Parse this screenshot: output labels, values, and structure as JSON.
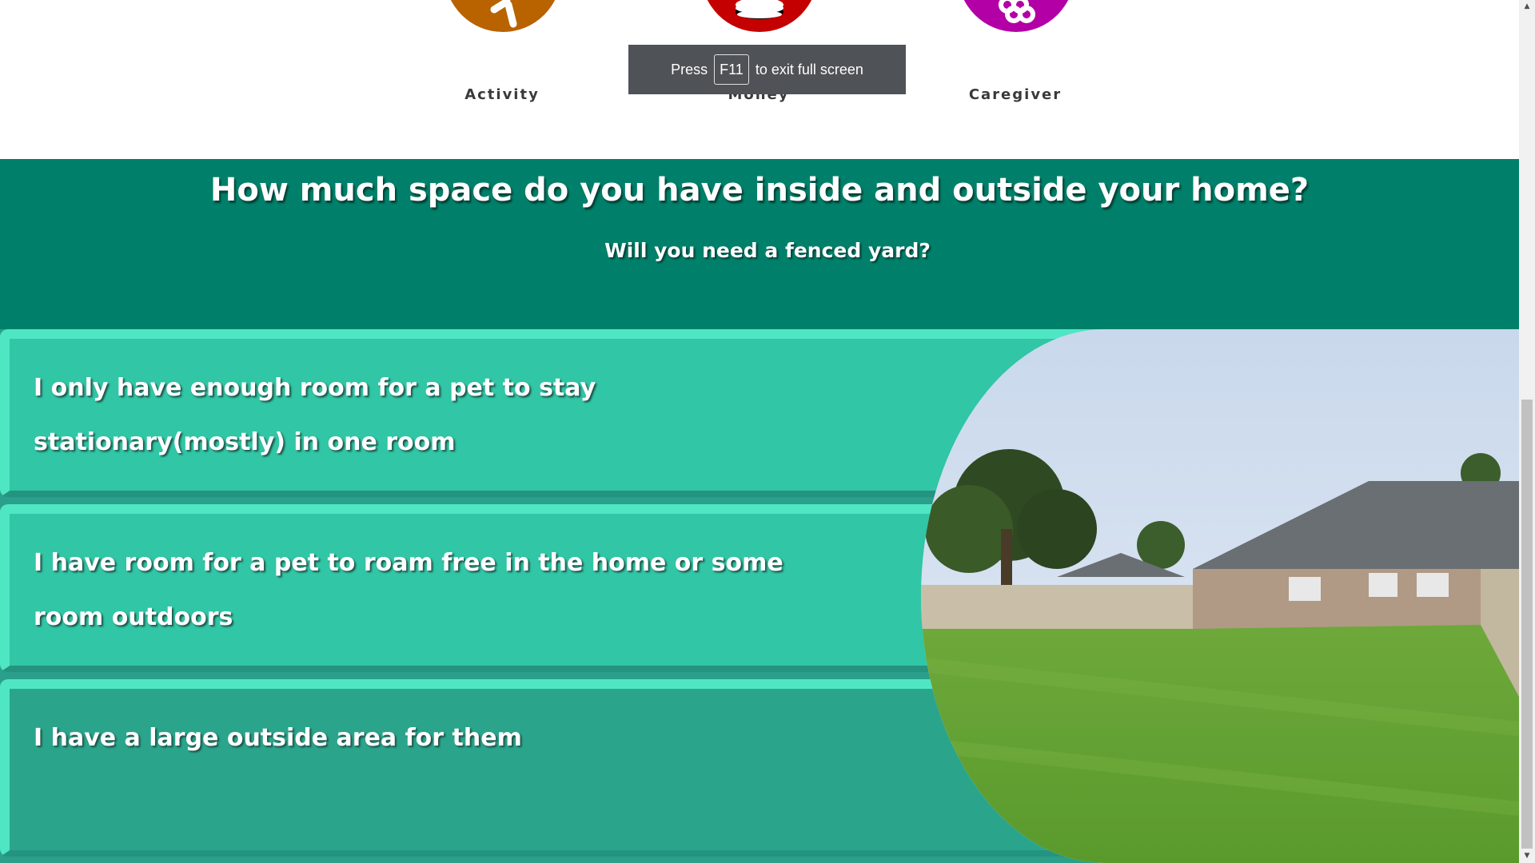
{
  "categories": [
    {
      "label": "Activity",
      "icon": "running-figure-icon",
      "color": "#b86200"
    },
    {
      "label": "Money",
      "icon": "coin-stack-icon",
      "color": "#c40000"
    },
    {
      "label": "Caregiver",
      "icon": "hands-icon",
      "color": "#b300a6"
    }
  ],
  "toast": {
    "press": "Press",
    "key": "F11",
    "message": "to exit full screen"
  },
  "header": {
    "title": "How much space do you have inside and outside your home?",
    "subtitle": "Will you need a fenced yard?"
  },
  "options": [
    {
      "text": "I only have enough room for a pet to stay stationary(mostly) in one room"
    },
    {
      "text": "I have room for a pet to roam free in the home or some room outdoors"
    },
    {
      "text": "I have a large outside area for them"
    }
  ],
  "photo": {
    "subject": "backyard-lawn-photo"
  },
  "colors": {
    "header_bg": "#00806a",
    "option_bg": "#30c6a6",
    "option_border": "#4fe6c4"
  }
}
